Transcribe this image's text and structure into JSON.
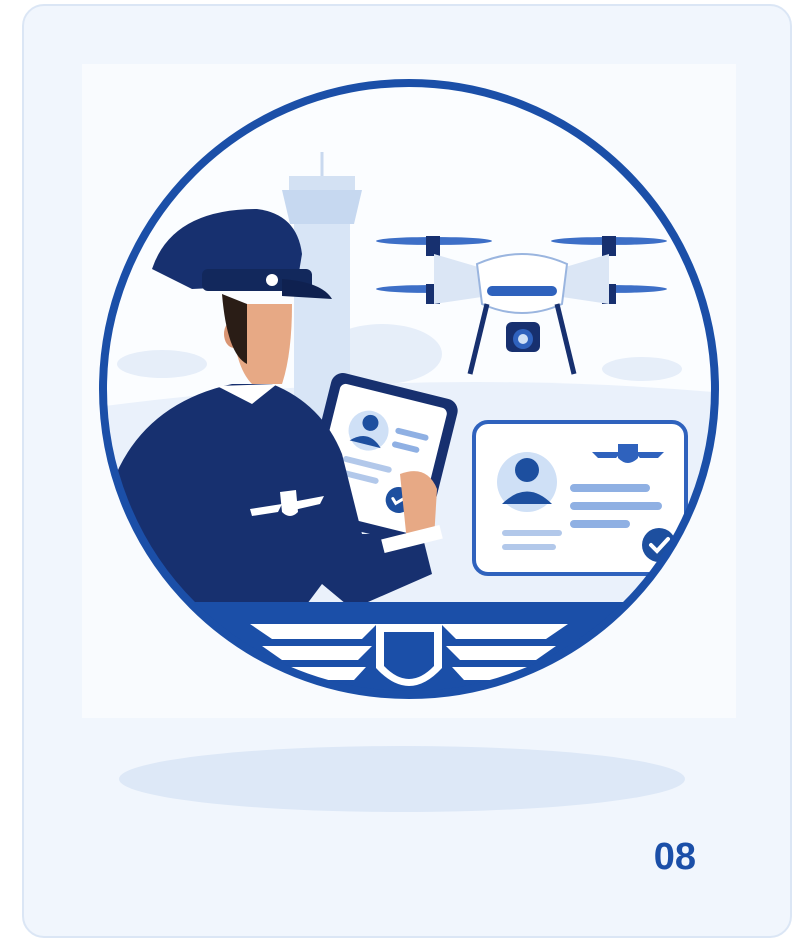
{
  "card": {
    "number": "08"
  },
  "illustration": {
    "subject": "pilot-with-tablet-and-drone",
    "icons": [
      "pilot-icon",
      "tablet-icon",
      "drone-icon",
      "id-card-icon",
      "wings-shield-icon",
      "checkmark-icon",
      "control-tower-icon"
    ]
  },
  "colors": {
    "card_background": "#f1f6fd",
    "card_border": "#dbe6f5",
    "accent_blue": "#1b4fa8",
    "navy": "#17306f",
    "light_blue": "#cfe0f6"
  }
}
